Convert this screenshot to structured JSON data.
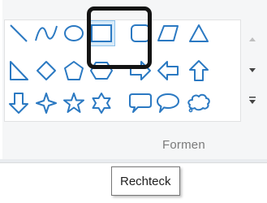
{
  "group": {
    "label": "Formen"
  },
  "tooltip": {
    "text": "Rechteck"
  },
  "gallery": {
    "shape_color": "#2b79c2",
    "shape_fill": "#ffffff",
    "hover_background": "#d9ebf9",
    "highlight_color": "#141414",
    "selected_shape": "rectangle",
    "shapes": [
      "line",
      "curve",
      "oval",
      "rectangle",
      "rounded-rectangle",
      "parallelogram",
      "triangle",
      "right-triangle",
      "diamond",
      "pentagon",
      "hexagon",
      "right-arrow",
      "left-arrow",
      "up-arrow",
      "down-arrow",
      "four-point-star",
      "five-point-star",
      "six-point-star",
      "rounded-rectangle-callout",
      "oval-callout",
      "cloud-callout"
    ]
  },
  "scroll": {
    "up_icon": "scroll-up-icon",
    "down_icon": "scroll-down-icon",
    "more_icon": "gallery-more-icon"
  }
}
